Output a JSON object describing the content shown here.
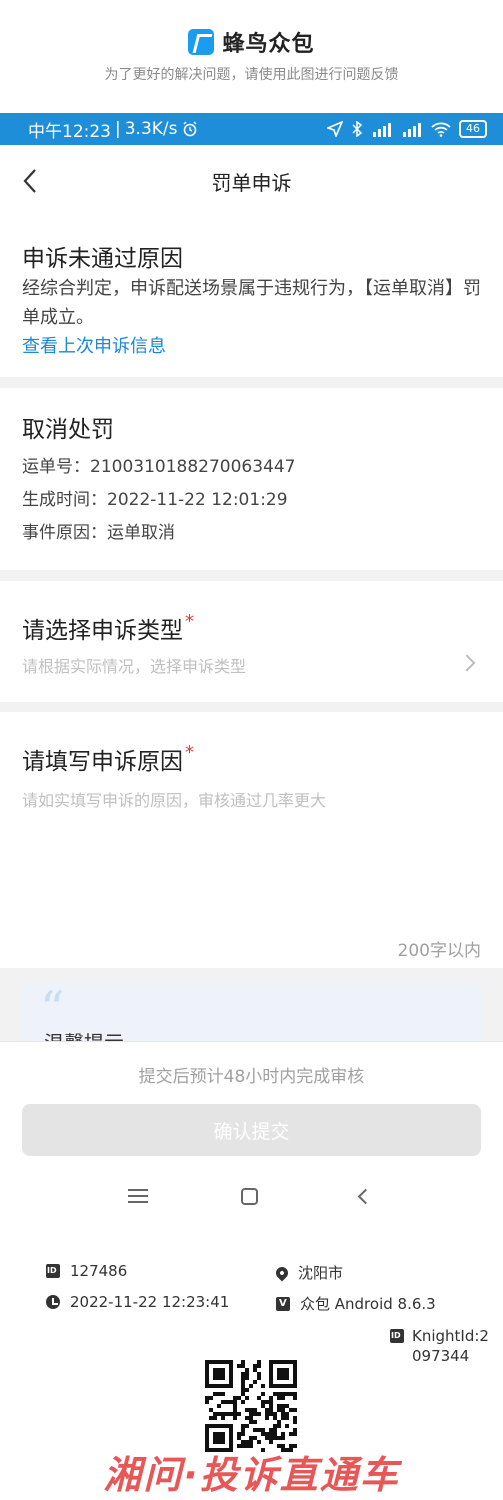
{
  "header": {
    "app_name": "蜂鸟众包",
    "subtitle": "为了更好的解决问题，请使用此图进行问题反馈"
  },
  "statusbar": {
    "time": "中午12:23",
    "speed": "3.3K/s",
    "battery": "46"
  },
  "navbar": {
    "title": "罚单申诉"
  },
  "rejection": {
    "title": "申诉未通过原因",
    "reason": "经综合判定，申诉配送场景属于违规行为，【运单取消】罚单成立。",
    "link": "查看上次申诉信息"
  },
  "penalty": {
    "title": "取消处罚",
    "order_label": "运单号：",
    "order_no": "2100310188270063447",
    "time_label": "生成时间：",
    "time": "2022-11-22 12:01:29",
    "reason_label": "事件原因：",
    "reason": "运单取消"
  },
  "appeal_type": {
    "title": "请选择申诉类型",
    "required_mark": "*",
    "placeholder": "请根据实际情况，选择申诉类型"
  },
  "appeal_reason": {
    "title": "请填写申诉原因",
    "required_mark": "*",
    "placeholder": "请如实填写申诉的原因，审核通过几率更大",
    "counter": "200字以内"
  },
  "tip": {
    "quote": "“",
    "title": "温馨提示"
  },
  "bottom": {
    "eta": "提交后预计48小时内完成审核",
    "submit": "确认提交"
  },
  "footer": {
    "id": "127486",
    "city": "沈阳市",
    "datetime": "2022-11-22 12:23:41",
    "app_version": "众包 Android 8.6.3",
    "knight_id": "KnightId:2097344",
    "watermark": "湘问·投诉直通车"
  },
  "colors": {
    "accent": "#1e88d8",
    "statusbar": "#1e8ed8",
    "required": "#e23a3a",
    "watermark": "#e64545"
  }
}
